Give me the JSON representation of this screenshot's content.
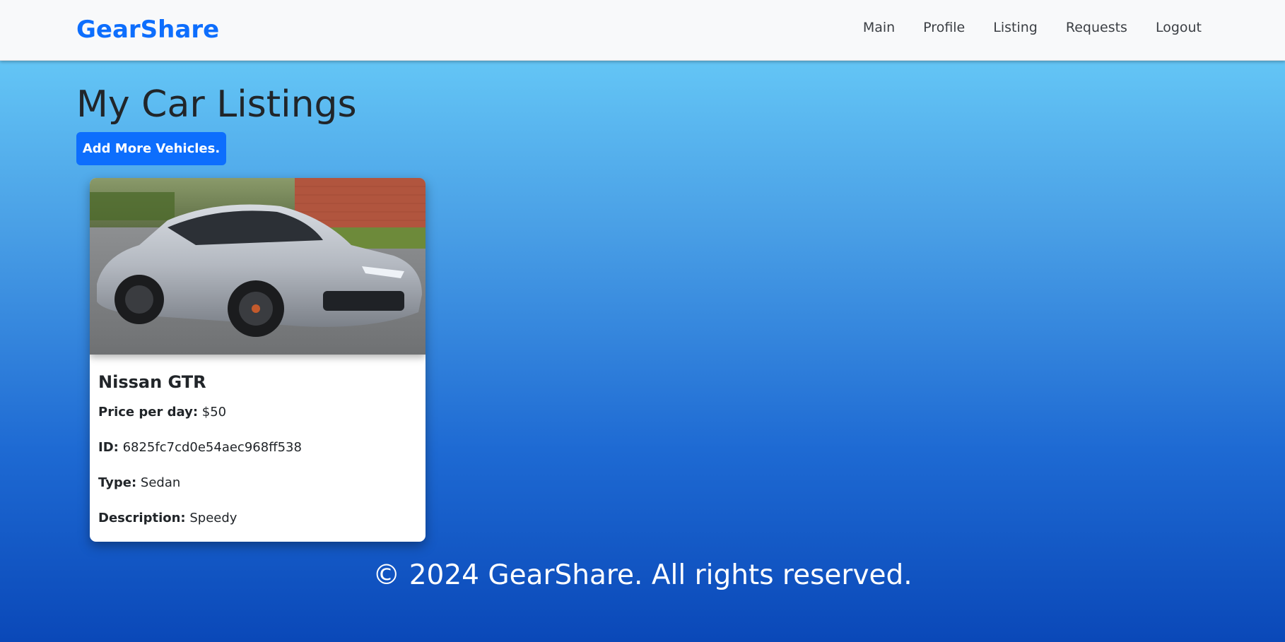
{
  "navbar": {
    "brand": "GearShare",
    "links": [
      "Main",
      "Profile",
      "Listing",
      "Requests",
      "Logout"
    ]
  },
  "page": {
    "title": "My Car Listings",
    "add_button_label": "Add More Vehicles."
  },
  "listing": {
    "name": "Nissan GTR",
    "price_label": "Price per day:",
    "price_value": "$50",
    "id_label": "ID:",
    "id_value": "6825fc7cd0e54aec968ff538",
    "type_label": "Type:",
    "type_value": "Sedan",
    "description_label": "Description:",
    "description_value": "Speedy"
  },
  "footer": {
    "text": "© 2024 GearShare. All rights reserved."
  },
  "colors": {
    "brand": "#0d6efd",
    "button": "#0d6efd",
    "car_body": "#b9bec6"
  }
}
